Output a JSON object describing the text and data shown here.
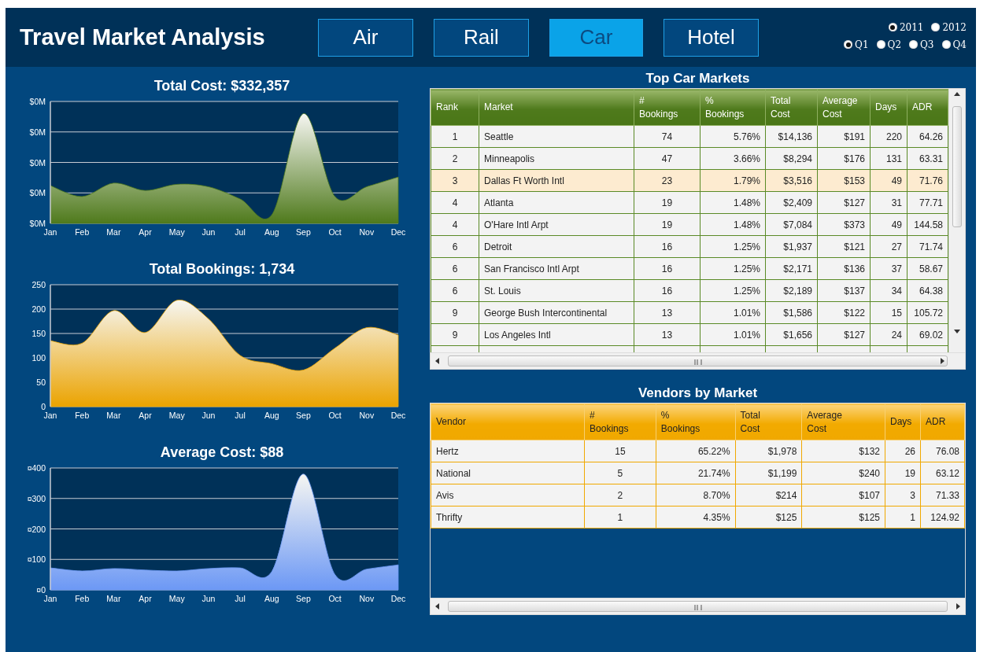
{
  "header": {
    "title": "Travel Market Analysis"
  },
  "tabs": [
    {
      "label": "Air",
      "selected": false
    },
    {
      "label": "Rail",
      "selected": false
    },
    {
      "label": "Car",
      "selected": true
    },
    {
      "label": "Hotel",
      "selected": false
    }
  ],
  "years": [
    {
      "label": "2011",
      "selected": true
    },
    {
      "label": "2012",
      "selected": false
    }
  ],
  "quarters": [
    {
      "label": "Q1",
      "selected": true
    },
    {
      "label": "Q2",
      "selected": false
    },
    {
      "label": "Q3",
      "selected": false
    },
    {
      "label": "Q4",
      "selected": false
    }
  ],
  "total_cost": {
    "title": "Total Cost: $332,357",
    "y_tick_labels": [
      "$0M",
      "$0M",
      "$0M",
      "$0M",
      "$0M"
    ],
    "x_labels": [
      "Jan",
      "Feb",
      "Mar",
      "Apr",
      "May",
      "Jun",
      "Jul",
      "Aug",
      "Sep",
      "Oct",
      "Nov",
      "Dec"
    ]
  },
  "total_bookings": {
    "chart_data": {
      "type": "area",
      "grid": true,
      "title": "Total Bookings: 1,734",
      "categories": [
        "Jan",
        "Feb",
        "Mar",
        "Apr",
        "May",
        "Jun",
        "Jul",
        "Aug",
        "Sep",
        "Oct",
        "Nov",
        "Dec"
      ],
      "ylim": [
        0,
        250
      ],
      "yticks": [
        0,
        50,
        100,
        150,
        200,
        250
      ],
      "series": [
        {
          "color": "#eba300",
          "values": [
            135,
            130,
            197,
            152,
            218,
            180,
            105,
            88,
            75,
            120,
            162,
            147
          ]
        }
      ]
    }
  },
  "average_cost": {
    "chart_data": {
      "type": "area",
      "grid": true,
      "title": "Average Cost: $88",
      "categories": [
        "Jan",
        "Feb",
        "Mar",
        "Apr",
        "May",
        "Jun",
        "Jul",
        "Aug",
        "Sep",
        "Oct",
        "Nov",
        "Dec"
      ],
      "ylim": [
        0,
        400
      ],
      "yticks": [
        {
          "value": 0,
          "label": "¤0"
        },
        {
          "value": 100,
          "label": "¤100"
        },
        {
          "value": 200,
          "label": "¤200"
        },
        {
          "value": 300,
          "label": "¤300"
        },
        {
          "value": 400,
          "label": "¤400"
        }
      ],
      "series": [
        {
          "color": "#6c98f5",
          "values": [
            72,
            62,
            70,
            65,
            62,
            70,
            72,
            60,
            380,
            50,
            68,
            82
          ]
        }
      ]
    }
  },
  "top_markets": {
    "title": "Top Car Markets",
    "columns": [
      "Rank",
      "Market",
      "#\nBookings",
      "%\nBookings",
      "Total\nCost",
      "Average\nCost",
      "Days",
      "ADR"
    ],
    "rows": [
      {
        "selected": false,
        "cells": [
          "1",
          "Seattle",
          "74",
          "5.76%",
          "$14,136",
          "$191",
          "220",
          "64.26"
        ]
      },
      {
        "selected": false,
        "cells": [
          "2",
          "Minneapolis",
          "47",
          "3.66%",
          "$8,294",
          "$176",
          "131",
          "63.31"
        ]
      },
      {
        "selected": true,
        "cells": [
          "3",
          "Dallas Ft Worth Intl",
          "23",
          "1.79%",
          "$3,516",
          "$153",
          "49",
          "71.76"
        ]
      },
      {
        "selected": false,
        "cells": [
          "4",
          "Atlanta",
          "19",
          "1.48%",
          "$2,409",
          "$127",
          "31",
          "77.71"
        ]
      },
      {
        "selected": false,
        "cells": [
          "4",
          "O'Hare Intl Arpt",
          "19",
          "1.48%",
          "$7,084",
          "$373",
          "49",
          "144.58"
        ]
      },
      {
        "selected": false,
        "cells": [
          "6",
          "Detroit",
          "16",
          "1.25%",
          "$1,937",
          "$121",
          "27",
          "71.74"
        ]
      },
      {
        "selected": false,
        "cells": [
          "6",
          "San Francisco Intl Arpt",
          "16",
          "1.25%",
          "$2,171",
          "$136",
          "37",
          "58.67"
        ]
      },
      {
        "selected": false,
        "cells": [
          "6",
          "St. Louis",
          "16",
          "1.25%",
          "$2,189",
          "$137",
          "34",
          "64.38"
        ]
      },
      {
        "selected": false,
        "cells": [
          "9",
          "George Bush Intercontinental",
          "13",
          "1.01%",
          "$1,586",
          "$122",
          "15",
          "105.72"
        ]
      },
      {
        "selected": false,
        "cells": [
          "9",
          "Los Angeles Intl",
          "13",
          "1.01%",
          "$1,656",
          "$127",
          "24",
          "69.02"
        ]
      }
    ]
  },
  "vendors": {
    "title": "Vendors by Market",
    "columns": [
      "Vendor",
      "#\nBookings",
      "%\nBookings",
      "Total\nCost",
      "Average\nCost",
      "Days",
      "ADR"
    ],
    "rows": [
      {
        "cells": [
          "Hertz",
          "15",
          "65.22%",
          "$1,978",
          "$132",
          "26",
          "76.08"
        ]
      },
      {
        "cells": [
          "National",
          "5",
          "21.74%",
          "$1,199",
          "$240",
          "19",
          "63.12"
        ]
      },
      {
        "cells": [
          "Avis",
          "2",
          "8.70%",
          "$214",
          "$107",
          "3",
          "71.33"
        ]
      },
      {
        "cells": [
          "Thrifty",
          "1",
          "4.35%",
          "$125",
          "$125",
          "1",
          "124.92"
        ]
      }
    ]
  }
}
